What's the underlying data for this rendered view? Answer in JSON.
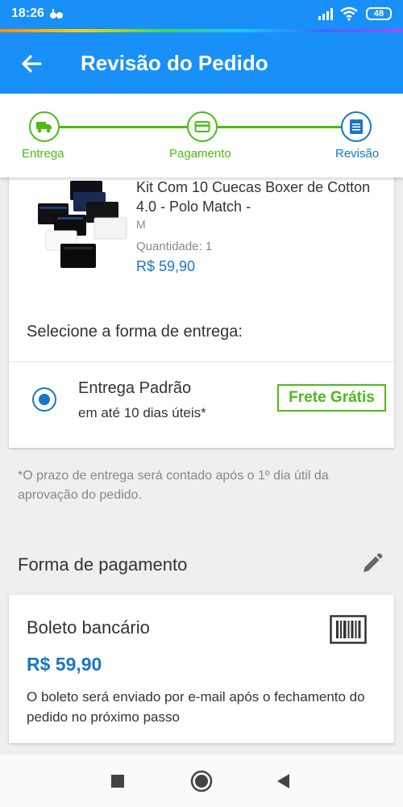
{
  "status_bar": {
    "time": "18:26",
    "battery": "48",
    "icons": [
      "notification-icon",
      "signal-icon",
      "wifi-icon",
      "battery-icon"
    ]
  },
  "app_bar": {
    "title": "Revisão do Pedido",
    "back_icon": "arrow-left-icon"
  },
  "stepper": {
    "steps": [
      {
        "label": "Entrega",
        "icon": "truck-icon",
        "color": "#4cbb17"
      },
      {
        "label": "Pagamento",
        "icon": "card-icon",
        "color": "#4cbb17"
      },
      {
        "label": "Revisão",
        "icon": "list-icon",
        "color": "#1a76c8"
      }
    ]
  },
  "product": {
    "name": "Kit Com 10 Cuecas Boxer de Cotton 4.0 - Polo Match -",
    "size": "M",
    "quantity": "Quantidade:  1",
    "price": "R$ 59,90"
  },
  "delivery": {
    "section_label": "Selecione a forma de entrega:",
    "option_title": "Entrega Padrão",
    "option_subtitle": "em até 10 dias úteis*",
    "badge": "Frete Grátis",
    "selected": true,
    "note": "*O prazo de entrega será contado após o 1º dia útil da aprovação do pedido."
  },
  "payment": {
    "section_title": "Forma de pagamento",
    "method": "Boleto bancário",
    "price": "R$ 59,90",
    "description": "O boleto será enviado por e-mail após o fechamento do pedido no próximo passo"
  },
  "colors": {
    "primary": "#1890f8",
    "accent_blue": "#1a76c8",
    "success_green": "#4cbb17"
  }
}
